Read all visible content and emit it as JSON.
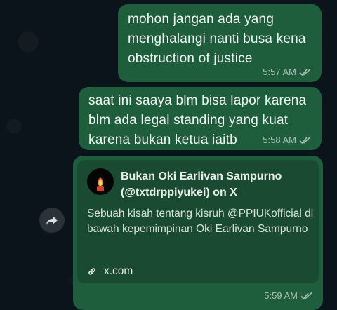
{
  "messages": [
    {
      "text": "mohon jangan ada yang menghalangi nanti busa kena obstruction of justice",
      "time": "5:57 AM",
      "status": "read"
    },
    {
      "text": "saat ini saaya blm bisa lapor karena blm ada legal standing yang kuat karena bukan ketua iaitb",
      "time": "5:58 AM",
      "status": "read"
    },
    {
      "link_preview": {
        "title": "Bukan Oki Earlivan Sampurno (@txtdrppiyukei) on X",
        "description": "Sebuah kisah tentang kisruh @PPIUKofficial di bawah kepemimpinan Oki Earlivan Sampurno",
        "domain": "x.com",
        "avatar_icon": "candle-icon"
      },
      "time": "5:59 AM",
      "status": "read"
    }
  ],
  "colors": {
    "bubble_out": "#1f5e3d",
    "preview_card": "#1a4a31",
    "background": "#0b141a"
  },
  "icons": {
    "read_receipt": "double-check-icon",
    "share": "forward-arrow-icon",
    "link": "link-icon"
  }
}
